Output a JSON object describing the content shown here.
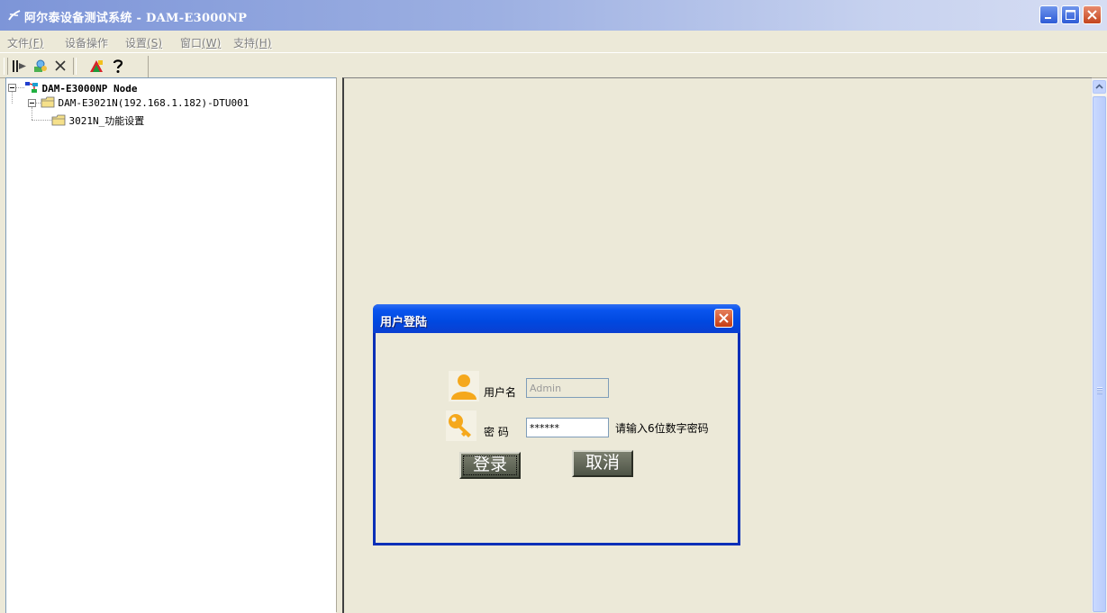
{
  "window": {
    "title": "阿尔泰设备测试系统 - DAM-E3000NP",
    "colors": {
      "titlebar_start": "#7d95d8",
      "titlebar_end": "#d6ddf3",
      "background": "#ece9d8"
    },
    "icons": [
      "app-icon",
      "minimize-icon",
      "maximize-icon",
      "close-icon"
    ]
  },
  "menubar": {
    "items": [
      {
        "label": "文件",
        "hotkey": "(F)"
      },
      {
        "label": "设备操作",
        "hotkey": ""
      },
      {
        "label": "设置",
        "hotkey": "(S)"
      },
      {
        "label": "窗口",
        "hotkey": "(W)"
      },
      {
        "label": "支持",
        "hotkey": "(H)"
      }
    ]
  },
  "toolbar": {
    "buttons": [
      "connect-icon",
      "search-device-icon",
      "disconnect-icon",
      "config-icon",
      "help-icon"
    ]
  },
  "tree": {
    "root": {
      "label": "DAM-E3000NP Node",
      "icon": "network-icon"
    },
    "device": {
      "label": "DAM-E3021N(192.168.1.182)-DTU001",
      "icon": "folder-icon"
    },
    "child": {
      "label": "3021N_功能设置",
      "icon": "folder-icon"
    }
  },
  "login_dialog": {
    "title": "用户登陆",
    "username_label": "用户名",
    "username_value": "Admin",
    "password_label": "密  码",
    "password_value": "******",
    "password_hint": "请输入6位数字密码",
    "login_button": "登录",
    "cancel_button": "取消",
    "colors": {
      "titlebar": "#0a55ee",
      "frame": "#0a2fb8",
      "button": "#5f6455"
    },
    "icons": [
      "user-icon",
      "key-icon",
      "close-icon"
    ]
  }
}
